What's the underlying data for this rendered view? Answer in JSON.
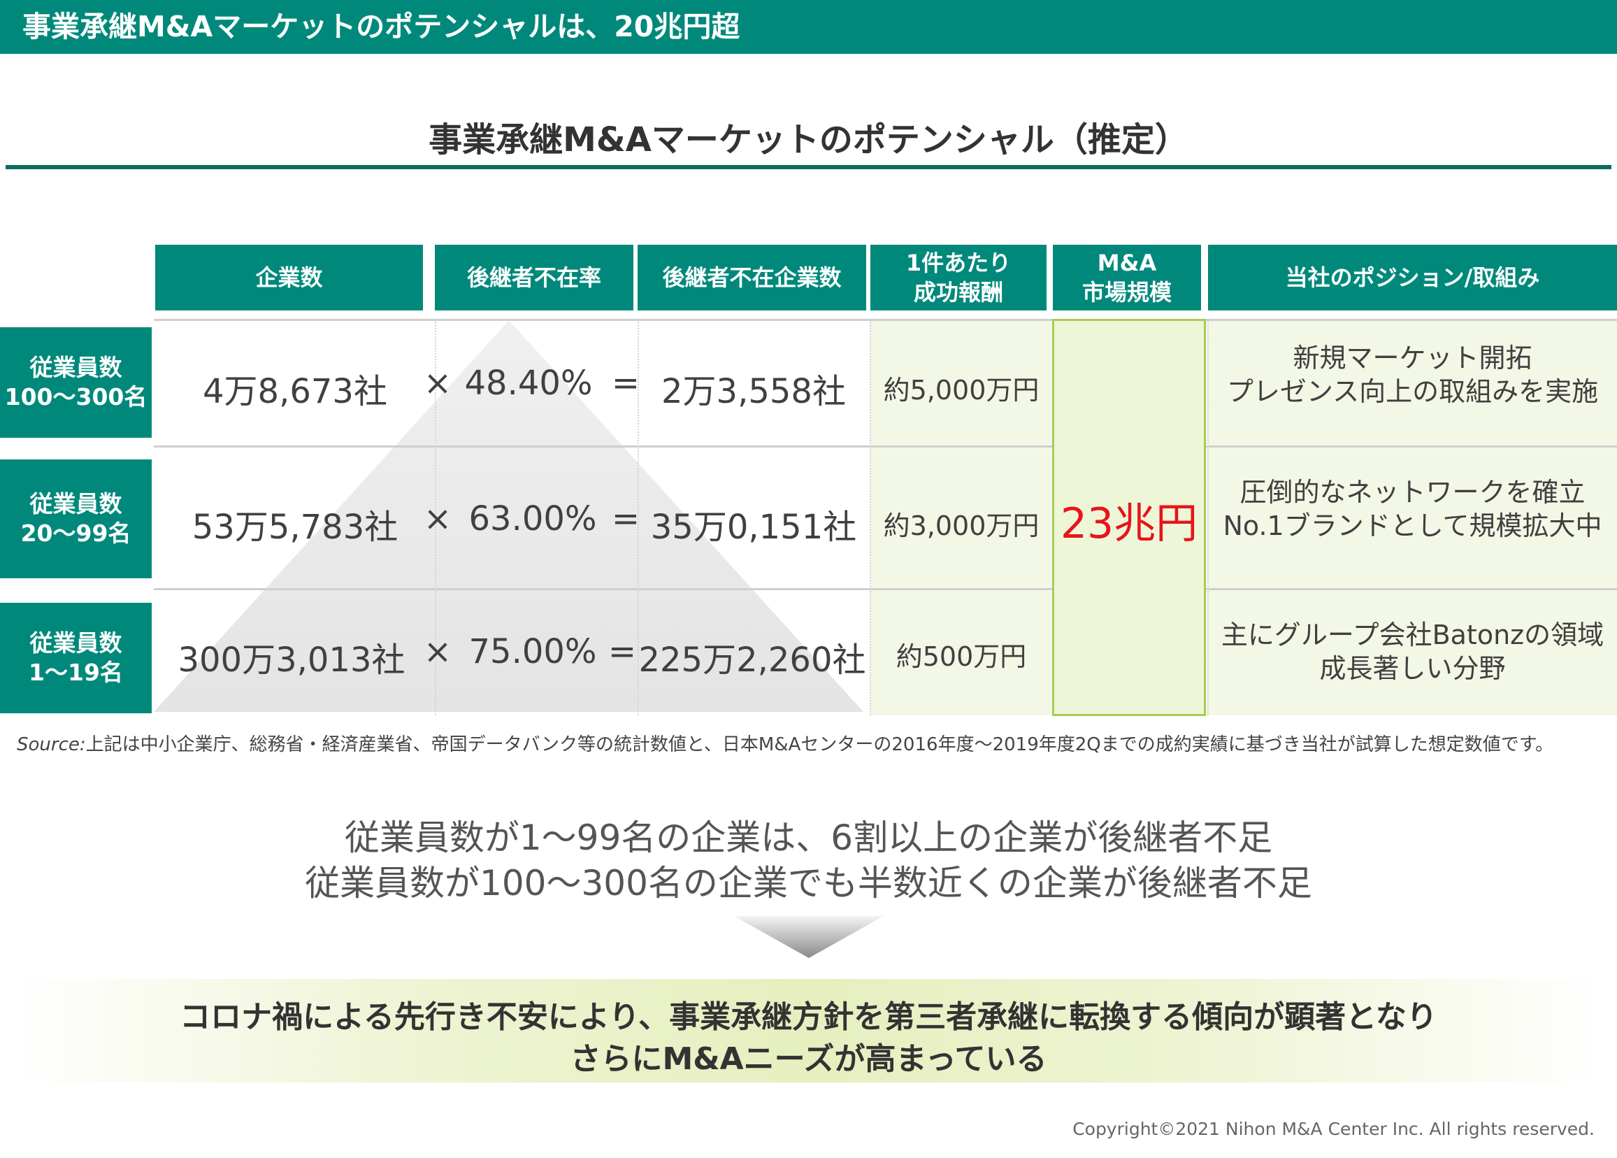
{
  "banner": {
    "title": "事業承継M&Aマーケットのポテンシャルは、20兆円超"
  },
  "section": {
    "title": "事業承継M&Aマーケットのポテンシャル（推定）"
  },
  "table": {
    "headers": {
      "companies": "企業数",
      "no_successor_rate": "後継者不在率",
      "no_successor_companies": "後継者不在企業数",
      "fee_line1": "1件あたり",
      "fee_line2": "成功報酬",
      "market_line1": "M&A",
      "market_line2": "市場規模",
      "position": "当社のポジション/取組み"
    },
    "operators": {
      "times": "×",
      "equals": "="
    },
    "rows": [
      {
        "label_line1": "従業員数",
        "label_line2": "100〜300名",
        "companies": "4万8,673社",
        "rate": "48.40%",
        "no_successor": "2万3,558社",
        "fee": "約5,000万円",
        "position_line1": "新規マーケット開拓",
        "position_line2": "プレゼンス向上の取組みを実施"
      },
      {
        "label_line1": "従業員数",
        "label_line2": "20〜99名",
        "companies": "53万5,783社",
        "rate": "63.00%",
        "no_successor": "35万0,151社",
        "fee": "約3,000万円",
        "position_line1": "圧倒的なネットワークを確立",
        "position_line2": "No.1ブランドとして規模拡大中"
      },
      {
        "label_line1": "従業員数",
        "label_line2": "1〜19名",
        "companies": "300万3,013社",
        "rate": "75.00%",
        "no_successor": "225万2,260社",
        "fee": "約500万円",
        "position_line1": "主にグループ会社Batonzの領域",
        "position_line2": "成長著しい分野"
      }
    ],
    "market_size": "23兆円"
  },
  "source": {
    "prefix": "Source:",
    "text": "上記は中小企業庁、総務省・経済産業省、帝国データバンク等の統計数値と、日本M&Aセンターの2016年度〜2019年度2Qまでの成約実績に基づき当社が試算した想定数値です。"
  },
  "summary": {
    "line1": "従業員数が1〜99名の企業は、6割以上の企業が後継者不足",
    "line2": "従業員数が100〜300名の企業でも半数近くの企業が後継者不足"
  },
  "conclusion": {
    "line1": "コロナ禍による先行き不安により、事業承継方針を第三者承継に転換する傾向が顕著となり",
    "line2": "さらにM&Aニーズが高まっている"
  },
  "footer": {
    "copyright": "Copyright©2021 Nihon M&A Center Inc. All rights reserved."
  },
  "colors": {
    "brand": "#00897b",
    "highlight": "#e8141a",
    "accent_green": "#a9cc56"
  }
}
